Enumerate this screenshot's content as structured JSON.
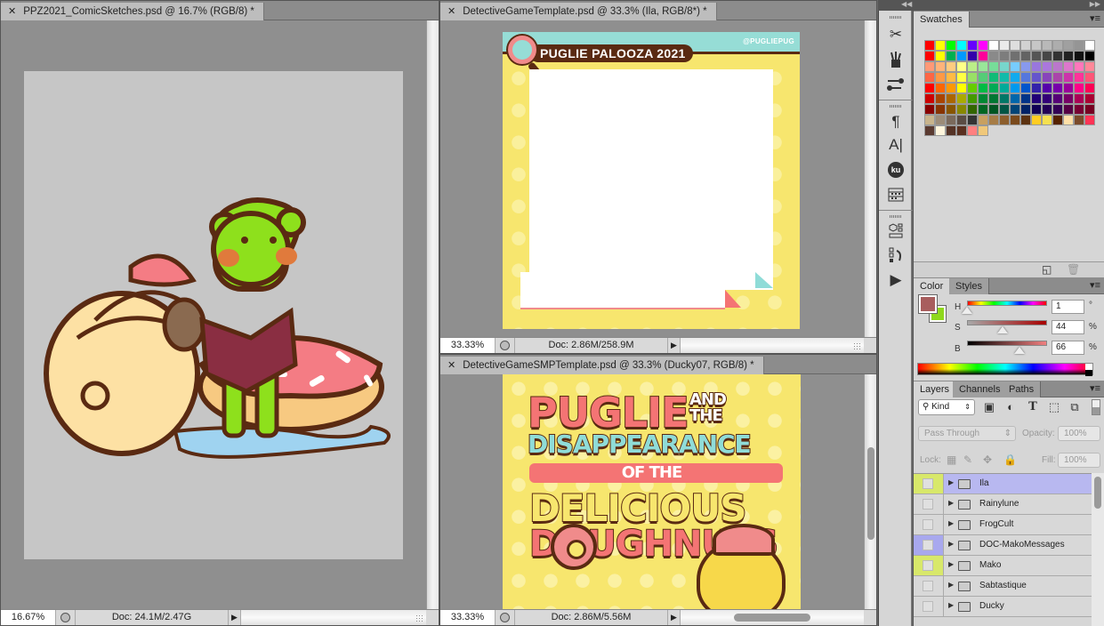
{
  "documents": [
    {
      "tab_title": "PPZ2021_ComicSketches.psd @ 16.7% (RGB/8) *",
      "zoom": "16.67%",
      "doc_info": "Doc: 24.1M/2.47G",
      "artwork": "Sketch: pug with mushroom hat, frog reading a book, pink doughnut"
    },
    {
      "tab_title": "DetectiveGameTemplate.psd @ 33.3% (Ila, RGB/8*) *",
      "zoom": "33.33%",
      "doc_info": "Doc: 2.86M/258.9M",
      "artwork": {
        "header_title": "PUGLIE PALOOZA 2021",
        "social_handle": "@PUGLIEPUG",
        "social_icons": [
          "facebook-icon",
          "twitter-icon",
          "instagram-icon"
        ]
      }
    },
    {
      "tab_title": "DetectiveGameSMPTemplate.psd @ 33.3% (Ducky07, RGB/8) *",
      "zoom": "33.33%",
      "doc_info": "Doc: 2.86M/5.56M",
      "artwork": {
        "line1": "PUGLIE",
        "line1_small": "AND THE",
        "line2": "DISAPPEARANCE",
        "line3": "OF THE",
        "line4": "DELICIOUS",
        "line5": "DOUGHNUTS"
      }
    }
  ],
  "tools": [
    {
      "icon": "tool-presets-icon"
    },
    {
      "icon": "brush-presets-icon"
    },
    {
      "icon": "clone-source-icon"
    },
    {
      "icon": "paragraph-icon",
      "glyph": "¶"
    },
    {
      "icon": "character-icon",
      "glyph": "A|"
    },
    {
      "icon": "kuler-icon",
      "glyph": "ku"
    },
    {
      "icon": "measurement-log-icon"
    },
    {
      "icon": "3d-icon"
    },
    {
      "icon": "history-icon"
    },
    {
      "icon": "actions-play-icon",
      "glyph": "▶"
    }
  ],
  "swatches_panel": {
    "tab": "Swatches",
    "colors": [
      "#ff0000",
      "#ffff00",
      "#00ff00",
      "#00ffff",
      "#6600ff",
      "#ff00ff",
      "#ffffff",
      "#ebebeb",
      "#dedede",
      "#d2d2d2",
      "#c6c6c6",
      "#b9b9b9",
      "#adadad",
      "#a0a0a0",
      "#959595",
      "#ffffff",
      "#ff0000",
      "#ffff00",
      "#00b050",
      "#0099ff",
      "#3300aa",
      "#ff0099",
      "#8a8a8a",
      "#7d7d7d",
      "#707070",
      "#636363",
      "#555555",
      "#474747",
      "#333333",
      "#222222",
      "#111111",
      "#000000",
      "#ff9977",
      "#ffb37a",
      "#ffcc80",
      "#ffff88",
      "#bbee88",
      "#99e699",
      "#77dd99",
      "#77d6cc",
      "#77ccff",
      "#8899ee",
      "#9977dd",
      "#aa77dd",
      "#bb77cc",
      "#dd77cc",
      "#ff77bb",
      "#ff8899",
      "#ff6644",
      "#ff9944",
      "#ffbb44",
      "#ffff44",
      "#99e066",
      "#55cc77",
      "#11bb77",
      "#11bbaa",
      "#11aaee",
      "#5577dd",
      "#6655cc",
      "#8844bb",
      "#aa44aa",
      "#cc33aa",
      "#ff3399",
      "#ff5577",
      "#ff0000",
      "#ff6600",
      "#ff9900",
      "#ffff00",
      "#66cc00",
      "#00bb44",
      "#00aa55",
      "#00aa99",
      "#0099ee",
      "#0055cc",
      "#3322aa",
      "#5500aa",
      "#7700aa",
      "#990099",
      "#ff0088",
      "#ff0055",
      "#cc0000",
      "#aa4400",
      "#aa6600",
      "#aaaa00",
      "#449900",
      "#008833",
      "#007733",
      "#007766",
      "#0066aa",
      "#003388",
      "#220077",
      "#330077",
      "#550077",
      "#770066",
      "#aa0055",
      "#aa0033",
      "#880000",
      "#883300",
      "#885500",
      "#888800",
      "#336600",
      "#006622",
      "#005522",
      "#005544",
      "#004477",
      "#002266",
      "#110055",
      "#220055",
      "#330055",
      "#550044",
      "#770033",
      "#770022",
      "#c8b48c",
      "#9c8c78",
      "#7a6a5c",
      "#5a4c44",
      "#333333",
      "#c8a060",
      "#a67c46",
      "#8c5e2c",
      "#7a4a1c",
      "#5c3210",
      "#ffcc22",
      "#f5e050",
      "#552200",
      "#ffe0a8",
      "#7a4a2a",
      "#ff3355",
      "#5a3a30",
      "#fff5dc",
      "#553326",
      "#5a3020",
      "#ff8080",
      "#f0c87a"
    ],
    "footer_icons": [
      "new-swatch-icon",
      "trash-icon"
    ]
  },
  "color_panel": {
    "tabs": [
      "Color",
      "Styles"
    ],
    "active_tab": "Color",
    "foreground": "#a85e5e",
    "background": "#8fd81c",
    "h_label": "H",
    "h_value": "1",
    "h_unit": "°",
    "s_label": "S",
    "s_value": "44",
    "s_unit": "%",
    "b_label": "B",
    "b_value": "66",
    "b_unit": "%",
    "h_fraction": 0.003,
    "s_fraction": 0.44,
    "b_fraction": 0.66
  },
  "layers_panel": {
    "tabs": [
      "Layers",
      "Channels",
      "Paths"
    ],
    "active_tab": "Layers",
    "filter_kind": "Kind",
    "blend_mode": "Pass Through",
    "opacity_label": "Opacity:",
    "opacity_value": "100%",
    "lock_label": "Lock:",
    "fill_label": "Fill:",
    "fill_value": "100%",
    "layers": [
      {
        "name": "Ila",
        "label_color": "#d8e86a",
        "selected": true
      },
      {
        "name": "Rainylune",
        "label_color": "",
        "selected": false
      },
      {
        "name": "FrogCult",
        "label_color": "",
        "selected": false
      },
      {
        "name": "DOC-MakoMessages",
        "label_color": "#a8a8ee",
        "selected": false
      },
      {
        "name": "Mako",
        "label_color": "#d8e86a",
        "selected": false
      },
      {
        "name": "Sabtastique",
        "label_color": "",
        "selected": false
      },
      {
        "name": "Ducky",
        "label_color": "",
        "selected": false
      }
    ]
  }
}
